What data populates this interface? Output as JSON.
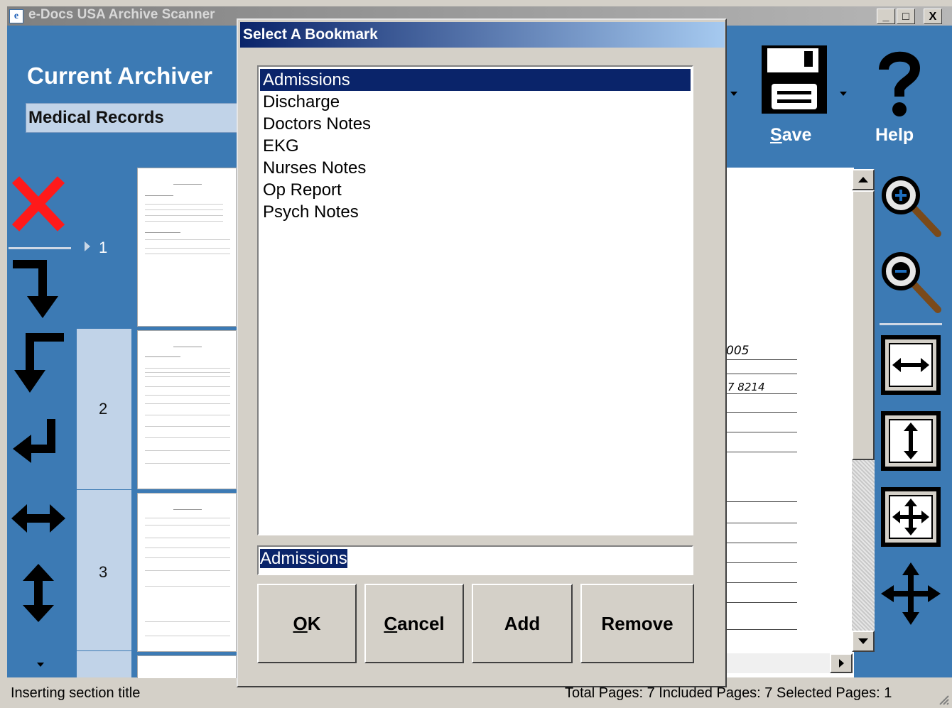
{
  "window": {
    "title": "e-Docs USA Archive Scanner",
    "app_icon_letter": "e",
    "min_glyph": "_",
    "max_glyph": "□",
    "close_glyph": "X"
  },
  "archiver": {
    "label": "Current Archiver",
    "value": "Medical Records"
  },
  "toolbar": {
    "save_label_key": "S",
    "save_label_rest": "ave",
    "help_label": "Help"
  },
  "thumbnails": {
    "rows": [
      {
        "number": "1",
        "selected": true
      },
      {
        "number": "2",
        "selected": false
      },
      {
        "number": "3",
        "selected": false
      }
    ]
  },
  "document_fragments": {
    "line1": "005",
    "line2": "7 8214"
  },
  "dialog": {
    "title": "Select A Bookmark",
    "items": [
      {
        "label": "Admissions",
        "selected": true
      },
      {
        "label": "Discharge",
        "selected": false
      },
      {
        "label": "Doctors Notes",
        "selected": false
      },
      {
        "label": "EKG",
        "selected": false
      },
      {
        "label": "Nurses Notes",
        "selected": false
      },
      {
        "label": "Op Report",
        "selected": false
      },
      {
        "label": "Psych Notes",
        "selected": false
      }
    ],
    "input_value": "Admissions",
    "buttons": {
      "ok_key": "O",
      "ok_rest": "K",
      "cancel_key": "C",
      "cancel_rest": "ancel",
      "add": "Add",
      "remove": "Remove"
    }
  },
  "status": {
    "left": "Inserting section title",
    "right": "Total Pages:  7  Included Pages:  7  Selected Pages:  1"
  },
  "colors": {
    "app_background": "#3c7ab4",
    "selection": "#0a246a",
    "delete_red": "#ff1a1a"
  }
}
